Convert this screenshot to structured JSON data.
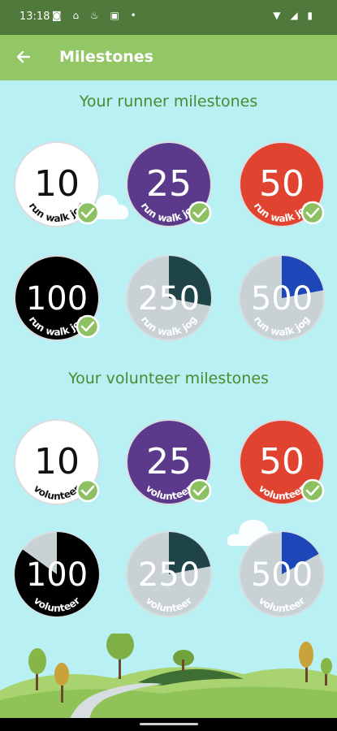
{
  "status_bar": {
    "time": "13:18",
    "left_icons": "◙ ⌂ ♨ ▣ •",
    "right_icons": "▼ ◢ ▮"
  },
  "app_bar": {
    "title": "Milestones",
    "back_icon": "arrow-left-icon"
  },
  "runner": {
    "heading": "Your runner milestones",
    "badges": [
      {
        "number": "10",
        "label": "run walk jog",
        "bg": "#ffffff",
        "text": "#111111",
        "earned": true,
        "progress": 1
      },
      {
        "number": "25",
        "label": "run walk jog",
        "bg": "#5b3a8c",
        "text": "#ffffff",
        "earned": true,
        "progress": 1
      },
      {
        "number": "50",
        "label": "run walk jog",
        "bg": "#e0432f",
        "text": "#ffffff",
        "earned": true,
        "progress": 1
      },
      {
        "number": "100",
        "label": "run walk jog",
        "bg": "#000000",
        "text": "#ffffff",
        "earned": true,
        "progress": 1
      },
      {
        "number": "250",
        "label": "run walk jog",
        "bg": "#1f4447",
        "text": "#ffffff",
        "earned": false,
        "progress": 0.28
      },
      {
        "number": "500",
        "label": "run walk jog",
        "bg": "#1d46b8",
        "text": "#ffffff",
        "earned": false,
        "progress": 0.22
      }
    ]
  },
  "volunteer": {
    "heading": "Your volunteer milestones",
    "badges": [
      {
        "number": "10",
        "label": "volunteer",
        "bg": "#ffffff",
        "text": "#111111",
        "earned": true,
        "progress": 1
      },
      {
        "number": "25",
        "label": "volunteer",
        "bg": "#5b3a8c",
        "text": "#ffffff",
        "earned": true,
        "progress": 1
      },
      {
        "number": "50",
        "label": "volunteer",
        "bg": "#e0432f",
        "text": "#ffffff",
        "earned": true,
        "progress": 1
      },
      {
        "number": "100",
        "label": "volunteer",
        "bg": "#000000",
        "text": "#ffffff",
        "earned": false,
        "progress": 0.85
      },
      {
        "number": "250",
        "label": "volunteer",
        "bg": "#1f4447",
        "text": "#ffffff",
        "earned": false,
        "progress": 0.22
      },
      {
        "number": "500",
        "label": "volunteer",
        "bg": "#1d46b8",
        "text": "#ffffff",
        "earned": false,
        "progress": 0.17
      }
    ]
  },
  "colors": {
    "earned_check": "#8dc062",
    "locked_fill": "#c8d2d4"
  }
}
